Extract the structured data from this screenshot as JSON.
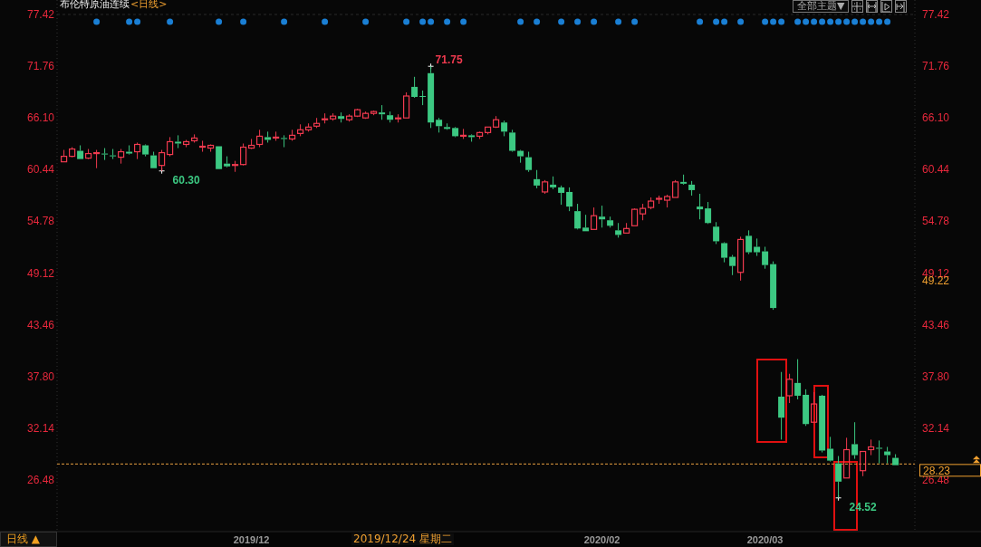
{
  "title": "布伦特原油连续",
  "period_tag": "<日线>",
  "toolbar": {
    "theme_dropdown": "全部主题▼",
    "icon_buttons": [
      {
        "kind": "crosshair"
      },
      {
        "kind": "range"
      },
      {
        "kind": "step"
      },
      {
        "kind": "end"
      }
    ]
  },
  "event_row": [
    {
      "marked": false
    },
    {
      "marked": false
    },
    {
      "marked": false
    },
    {
      "marked": false
    },
    {
      "marked": true
    },
    {
      "marked": false
    },
    {
      "marked": false
    },
    {
      "marked": false
    },
    {
      "marked": true
    },
    {
      "marked": true
    },
    {
      "marked": false
    },
    {
      "marked": false
    },
    {
      "marked": false
    },
    {
      "marked": true
    },
    {
      "marked": false
    },
    {
      "marked": false
    },
    {
      "marked": false
    },
    {
      "marked": false
    },
    {
      "marked": false
    },
    {
      "marked": true
    },
    {
      "marked": false
    },
    {
      "marked": false
    },
    {
      "marked": true
    },
    {
      "marked": false
    },
    {
      "marked": false
    },
    {
      "marked": false
    },
    {
      "marked": false
    },
    {
      "marked": true
    },
    {
      "marked": false
    },
    {
      "marked": false
    },
    {
      "marked": false
    },
    {
      "marked": false
    },
    {
      "marked": true
    },
    {
      "marked": false
    },
    {
      "marked": false
    },
    {
      "marked": false
    },
    {
      "marked": false
    },
    {
      "marked": true
    },
    {
      "marked": false
    },
    {
      "marked": false
    },
    {
      "marked": false
    },
    {
      "marked": false
    },
    {
      "marked": true
    },
    {
      "marked": false
    },
    {
      "marked": true
    },
    {
      "marked": true
    },
    {
      "marked": false
    },
    {
      "marked": true
    },
    {
      "marked": false
    },
    {
      "marked": true
    },
    {
      "marked": false
    },
    {
      "marked": false
    },
    {
      "marked": false
    },
    {
      "marked": false
    },
    {
      "marked": false
    },
    {
      "marked": false
    },
    {
      "marked": true
    },
    {
      "marked": false
    },
    {
      "marked": true
    },
    {
      "marked": false
    },
    {
      "marked": false
    },
    {
      "marked": true
    },
    {
      "marked": false
    },
    {
      "marked": true
    },
    {
      "marked": false
    },
    {
      "marked": true
    },
    {
      "marked": false
    },
    {
      "marked": false
    },
    {
      "marked": true
    },
    {
      "marked": false
    },
    {
      "marked": true
    },
    {
      "marked": false
    },
    {
      "marked": false
    },
    {
      "marked": false
    },
    {
      "marked": false
    },
    {
      "marked": false
    },
    {
      "marked": false
    },
    {
      "marked": false
    },
    {
      "marked": true
    },
    {
      "marked": false
    },
    {
      "marked": true
    },
    {
      "marked": true
    },
    {
      "marked": false
    },
    {
      "marked": true
    },
    {
      "marked": false
    },
    {
      "marked": false
    },
    {
      "marked": true
    },
    {
      "marked": true
    },
    {
      "marked": true
    },
    {
      "marked": false
    },
    {
      "marked": true
    },
    {
      "marked": true
    },
    {
      "marked": true
    },
    {
      "marked": true
    },
    {
      "marked": true
    },
    {
      "marked": true
    },
    {
      "marked": true
    },
    {
      "marked": true
    },
    {
      "marked": true
    },
    {
      "marked": true
    },
    {
      "marked": true
    },
    {
      "marked": true
    },
    {
      "marked": false
    }
  ],
  "chart_data": {
    "type": "candlestick",
    "ylim": [
      20.93,
      77.42
    ],
    "categories": [
      null,
      null,
      null,
      null,
      null,
      null,
      null,
      null,
      null,
      null,
      null,
      null,
      null,
      null,
      null,
      null,
      null,
      null,
      null,
      null,
      null,
      null,
      null,
      "2019/12",
      null,
      null,
      null,
      null,
      null,
      null,
      null,
      null,
      null,
      null,
      null,
      null,
      null,
      null,
      null,
      null,
      null,
      null,
      null,
      null,
      null,
      null,
      null,
      null,
      null,
      null,
      null,
      null,
      null,
      null,
      null,
      null,
      null,
      null,
      null,
      null,
      null,
      null,
      null,
      null,
      null,
      null,
      "2020/02",
      null,
      null,
      null,
      null,
      null,
      null,
      null,
      null,
      null,
      null,
      null,
      null,
      null,
      null,
      null,
      null,
      null,
      null,
      null,
      "2020/03",
      null,
      null,
      null,
      null,
      null,
      null,
      null,
      null,
      null,
      null,
      null,
      null,
      null,
      null,
      null,
      null
    ],
    "yticks": [
      {
        "value": 77.42,
        "label": "77.42"
      },
      {
        "value": 71.76,
        "label": "71.76"
      },
      {
        "value": 66.1,
        "label": "66.10"
      },
      {
        "value": 60.44,
        "label": "60.44"
      },
      {
        "value": 54.78,
        "label": "54.78"
      },
      {
        "value": 49.12,
        "label": "49.12"
      },
      {
        "value": 43.46,
        "label": "43.46"
      },
      {
        "value": 37.8,
        "label": "37.80"
      },
      {
        "value": 32.14,
        "label": "32.14"
      },
      {
        "value": 26.48,
        "label": "26.48"
      }
    ],
    "ohlc": [
      [
        61.3,
        62.6,
        61.3,
        61.9
      ],
      [
        61.9,
        62.9,
        61.8,
        62.7
      ],
      [
        62.5,
        63.1,
        61.6,
        61.6
      ],
      [
        61.7,
        62.7,
        61.6,
        62.2
      ],
      [
        62.2,
        62.6,
        60.6,
        62.3
      ],
      [
        62.2,
        62.8,
        61.5,
        62.1
      ],
      [
        62.0,
        62.7,
        61.6,
        61.9
      ],
      [
        61.8,
        62.7,
        61.1,
        62.4
      ],
      [
        62.4,
        63.1,
        62.1,
        62.2
      ],
      [
        62.4,
        63.4,
        61.6,
        63.2
      ],
      [
        63.1,
        63.2,
        61.9,
        62.1
      ],
      [
        62.0,
        62.4,
        60.6,
        60.6
      ],
      [
        60.9,
        62.6,
        60.3,
        62.3
      ],
      [
        62.1,
        64.0,
        61.9,
        63.5
      ],
      [
        63.5,
        64.2,
        62.8,
        63.3
      ],
      [
        63.2,
        63.7,
        62.9,
        63.5
      ],
      [
        63.6,
        64.3,
        63.4,
        63.9
      ],
      [
        62.9,
        63.6,
        62.4,
        63.0
      ],
      [
        62.8,
        63.2,
        62.4,
        63.1
      ],
      [
        63.0,
        63.0,
        60.5,
        60.5
      ],
      [
        61.1,
        61.9,
        60.7,
        60.8
      ],
      [
        60.9,
        61.4,
        60.2,
        61.0
      ],
      [
        61.0,
        63.3,
        60.9,
        62.9
      ],
      [
        62.8,
        63.8,
        62.7,
        63.1
      ],
      [
        63.2,
        64.8,
        62.9,
        64.1
      ],
      [
        64.0,
        64.6,
        63.4,
        63.7
      ],
      [
        63.9,
        64.6,
        63.6,
        64.0
      ],
      [
        63.9,
        64.2,
        62.9,
        63.8
      ],
      [
        63.8,
        64.8,
        63.6,
        64.2
      ],
      [
        64.4,
        65.4,
        64.1,
        64.8
      ],
      [
        64.8,
        65.5,
        64.6,
        65.1
      ],
      [
        65.2,
        66.1,
        65.0,
        65.5
      ],
      [
        65.9,
        66.6,
        65.5,
        66.0
      ],
      [
        66.0,
        66.6,
        65.8,
        66.3
      ],
      [
        66.3,
        66.7,
        65.6,
        66.0
      ],
      [
        65.9,
        66.5,
        65.7,
        66.3
      ],
      [
        66.3,
        67.1,
        66.2,
        67.0
      ],
      [
        66.1,
        66.8,
        66.0,
        66.6
      ],
      [
        66.6,
        66.9,
        66.4,
        66.8
      ],
      [
        66.7,
        67.5,
        65.9,
        66.5
      ],
      [
        66.4,
        66.8,
        65.6,
        65.9
      ],
      [
        66.0,
        66.5,
        65.6,
        66.1
      ],
      [
        66.1,
        68.9,
        66.1,
        68.5
      ],
      [
        69.5,
        70.6,
        68.3,
        68.4
      ],
      [
        68.5,
        69.1,
        67.5,
        68.4
      ],
      [
        71.0,
        71.75,
        65.0,
        65.6
      ],
      [
        65.9,
        66.1,
        64.5,
        65.2
      ],
      [
        65.1,
        65.5,
        64.8,
        64.9
      ],
      [
        65.0,
        65.1,
        64.0,
        64.1
      ],
      [
        64.1,
        64.9,
        63.8,
        64.2
      ],
      [
        64.2,
        64.3,
        63.5,
        64.0
      ],
      [
        64.1,
        64.6,
        63.8,
        64.5
      ],
      [
        64.5,
        65.1,
        64.3,
        65.1
      ],
      [
        65.1,
        66.3,
        65.0,
        65.9
      ],
      [
        65.6,
        65.8,
        64.1,
        64.6
      ],
      [
        64.5,
        64.8,
        62.4,
        62.5
      ],
      [
        62.5,
        62.6,
        61.2,
        61.9
      ],
      [
        61.8,
        62.4,
        60.2,
        60.4
      ],
      [
        59.4,
        60.4,
        58.4,
        58.7
      ],
      [
        58.0,
        59.3,
        57.8,
        59.1
      ],
      [
        58.8,
        59.7,
        58.3,
        58.5
      ],
      [
        58.5,
        58.7,
        56.6,
        57.9
      ],
      [
        58.0,
        58.5,
        55.9,
        56.4
      ],
      [
        55.9,
        56.7,
        53.9,
        54.0
      ],
      [
        54.1,
        55.5,
        53.7,
        53.7
      ],
      [
        53.9,
        56.3,
        53.9,
        55.4
      ],
      [
        55.3,
        56.5,
        54.1,
        55.0
      ],
      [
        54.9,
        55.3,
        54.1,
        54.3
      ],
      [
        53.8,
        54.6,
        53.0,
        53.3
      ],
      [
        53.5,
        54.6,
        53.5,
        54.0
      ],
      [
        54.3,
        56.2,
        54.3,
        56.1
      ],
      [
        55.6,
        56.7,
        54.9,
        56.2
      ],
      [
        56.3,
        57.4,
        56.1,
        57.0
      ],
      [
        57.2,
        57.6,
        56.7,
        57.3
      ],
      [
        57.1,
        57.7,
        56.3,
        57.5
      ],
      [
        57.4,
        59.3,
        57.4,
        59.1
      ],
      [
        59.1,
        59.9,
        58.8,
        58.9
      ],
      [
        58.8,
        59.2,
        57.6,
        58.2
      ],
      [
        56.4,
        57.8,
        55.0,
        56.1
      ],
      [
        56.2,
        56.9,
        54.5,
        54.6
      ],
      [
        54.2,
        54.7,
        52.3,
        52.6
      ],
      [
        52.4,
        52.5,
        50.3,
        50.8
      ],
      [
        50.9,
        51.1,
        48.9,
        49.9
      ],
      [
        49.2,
        53.1,
        48.3,
        52.8
      ],
      [
        53.2,
        53.8,
        51.2,
        51.4
      ],
      [
        52.0,
        52.9,
        51.0,
        51.4
      ],
      [
        51.5,
        52.0,
        49.6,
        50.0
      ],
      [
        50.1,
        50.4,
        45.1,
        45.3
      ],
      [
        35.6,
        38.3,
        30.9,
        33.3
      ],
      [
        35.7,
        38.1,
        34.9,
        37.5
      ],
      [
        37.1,
        39.7,
        35.3,
        35.7
      ],
      [
        35.8,
        36.4,
        32.4,
        32.6
      ],
      [
        32.8,
        36.1,
        32.8,
        34.8
      ],
      [
        35.7,
        35.8,
        29.5,
        29.7
      ],
      [
        29.9,
        31.2,
        28.5,
        28.6
      ],
      [
        28.3,
        29.1,
        24.52,
        26.3
      ],
      [
        26.7,
        31.1,
        26.7,
        29.8
      ],
      [
        30.4,
        32.8,
        28.8,
        29.2
      ],
      [
        27.5,
        29.6,
        26.9,
        29.6
      ],
      [
        29.8,
        30.9,
        29.2,
        30.1
      ],
      [
        30.0,
        30.8,
        28.3,
        29.9
      ],
      [
        29.6,
        30.1,
        28.3,
        29.2
      ],
      [
        28.9,
        29.3,
        28.1,
        28.1
      ]
    ],
    "annotations": [
      "71.75",
      "60.30",
      "24.52"
    ],
    "ref_lines": [
      {
        "axis": "y",
        "value": 28.23,
        "label": "28.23"
      }
    ]
  },
  "indicator_tag": "49.22",
  "cursor_date": "2019/12/24 星期二",
  "right_axis_labels": [
    "77.42",
    "71.76",
    "66.10",
    "60.44",
    "54.78",
    "49.12",
    "43.46",
    "37.80",
    "32.14",
    "26.48"
  ],
  "period_button": "日线 ▲"
}
